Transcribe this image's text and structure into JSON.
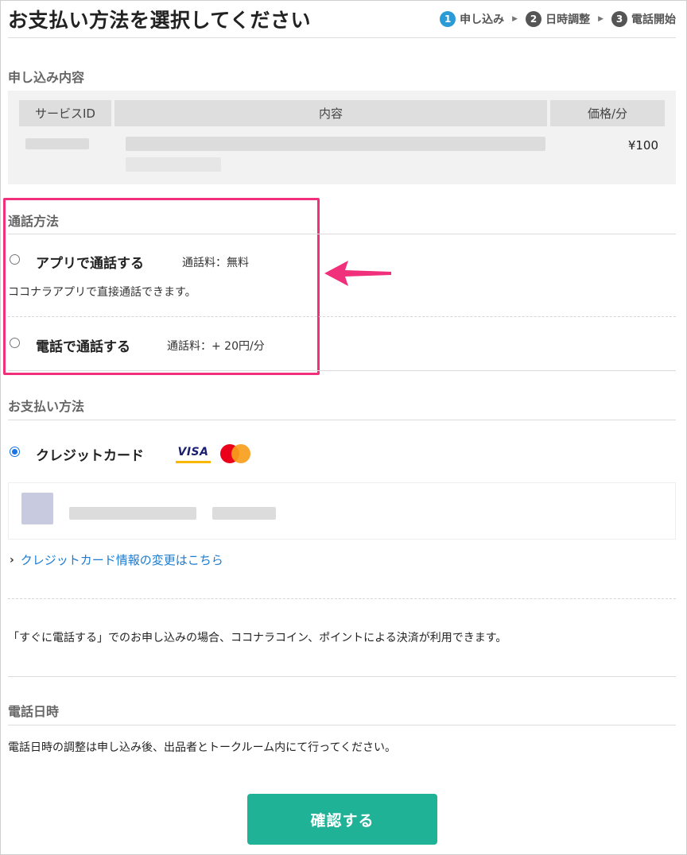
{
  "page_title": "お支払い方法を選択してください",
  "steps": [
    {
      "num": "1",
      "label": "申し込み",
      "active": true
    },
    {
      "num": "2",
      "label": "日時調整",
      "active": false
    },
    {
      "num": "3",
      "label": "電話開始",
      "active": false
    }
  ],
  "application": {
    "heading": "申し込み内容",
    "columns": [
      "サービスID",
      "内容",
      "価格/分"
    ],
    "price": "¥100"
  },
  "call_method": {
    "heading": "通話方法",
    "options": [
      {
        "label": "アプリで通話する",
        "fee": "通話料：無料",
        "description": "ココナラアプリで直接通話できます。",
        "selected": false
      },
      {
        "label": "電話で通話する",
        "fee": "通話料：+ 20円/分",
        "selected": false
      }
    ]
  },
  "payment": {
    "heading": "お支払い方法",
    "option_label": "クレジットカード",
    "selected": true,
    "card_brands": [
      "VISA",
      "mastercard"
    ],
    "change_link": "クレジットカード情報の変更はこちら",
    "note": "「すぐに電話する」でのお申し込みの場合、ココナラコイン、ポイントによる決済が利用できます。"
  },
  "call_datetime": {
    "heading": "電話日時",
    "note": "電話日時の調整は申し込み後、出品者とトークルーム内にて行ってください。"
  },
  "confirm_button": "確認する",
  "colors": {
    "accent_green": "#1fb296",
    "highlight_pink": "#f0307a",
    "link_blue": "#1a7bd0",
    "step_active": "#2a9bd7"
  }
}
